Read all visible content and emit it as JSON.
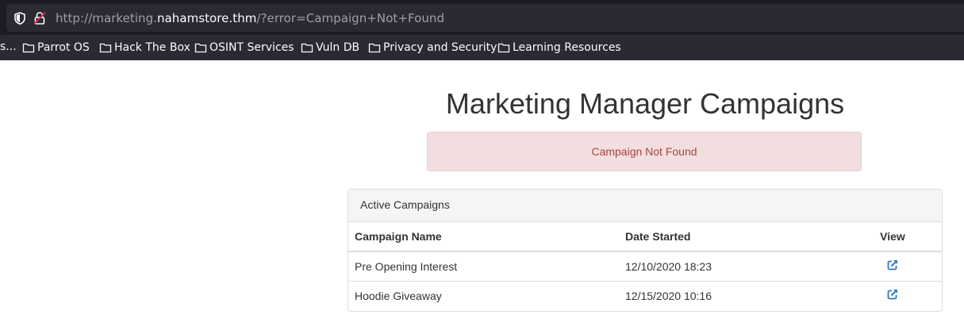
{
  "browser": {
    "url": {
      "prefix": "http://marketing.",
      "host": "nahamstore.thm",
      "suffix": "/?error=Campaign+Not+Found"
    },
    "bookmarks_overflow": "s...",
    "bookmarks": [
      {
        "label": "Parrot OS"
      },
      {
        "label": "Hack The Box"
      },
      {
        "label": "OSINT Services"
      },
      {
        "label": "Vuln DB"
      },
      {
        "label": "Privacy and Security"
      },
      {
        "label": "Learning Resources"
      }
    ]
  },
  "page": {
    "title": "Marketing Manager Campaigns",
    "alert": "Campaign Not Found",
    "panel_title": "Active Campaigns",
    "table": {
      "headers": [
        "Campaign Name",
        "Date Started",
        "View"
      ],
      "rows": [
        {
          "name": "Pre Opening Interest",
          "date": "12/10/2020 18:23",
          "view_icon": "external-link-icon"
        },
        {
          "name": "Hoodie Giveaway",
          "date": "12/15/2020 10:16",
          "view_icon": "external-link-icon"
        }
      ]
    }
  },
  "colors": {
    "chrome_bg": "#1c1b22",
    "urlbar_bg": "#2b2a33",
    "alert_bg": "#f2dede",
    "alert_text": "#a94442",
    "link": "#337ab7"
  }
}
